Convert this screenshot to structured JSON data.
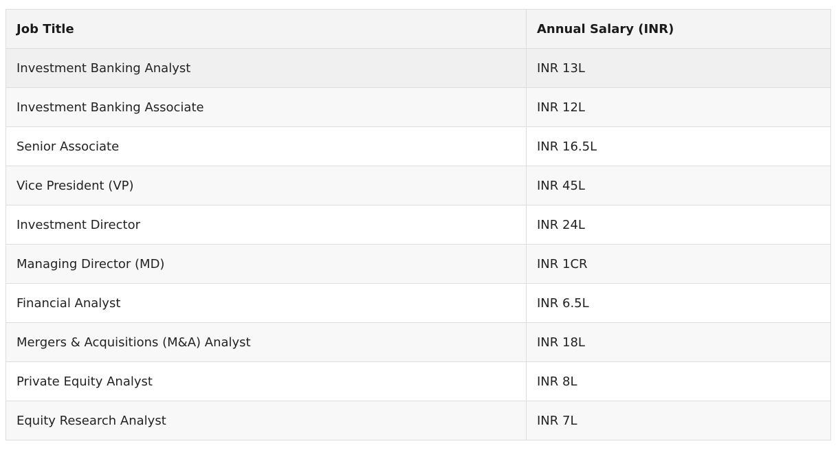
{
  "table": {
    "headers": [
      "Job Title",
      "Annual Salary (INR)"
    ],
    "rows": [
      [
        "Investment Banking Analyst",
        "INR 13L"
      ],
      [
        "Investment Banking Associate",
        "INR 12L"
      ],
      [
        "Senior Associate",
        "INR 16.5L"
      ],
      [
        "Vice President (VP)",
        "INR 45L"
      ],
      [
        "Investment Director",
        "INR 24L"
      ],
      [
        "Managing Director (MD)",
        "INR 1CR"
      ],
      [
        "Financial Analyst",
        "INR 6.5L"
      ],
      [
        "Mergers & Acquisitions (M&A) Analyst",
        "INR 18L"
      ],
      [
        "Private Equity Analyst",
        "INR 8L"
      ],
      [
        "Equity Research Analyst",
        "INR 7L"
      ]
    ]
  }
}
